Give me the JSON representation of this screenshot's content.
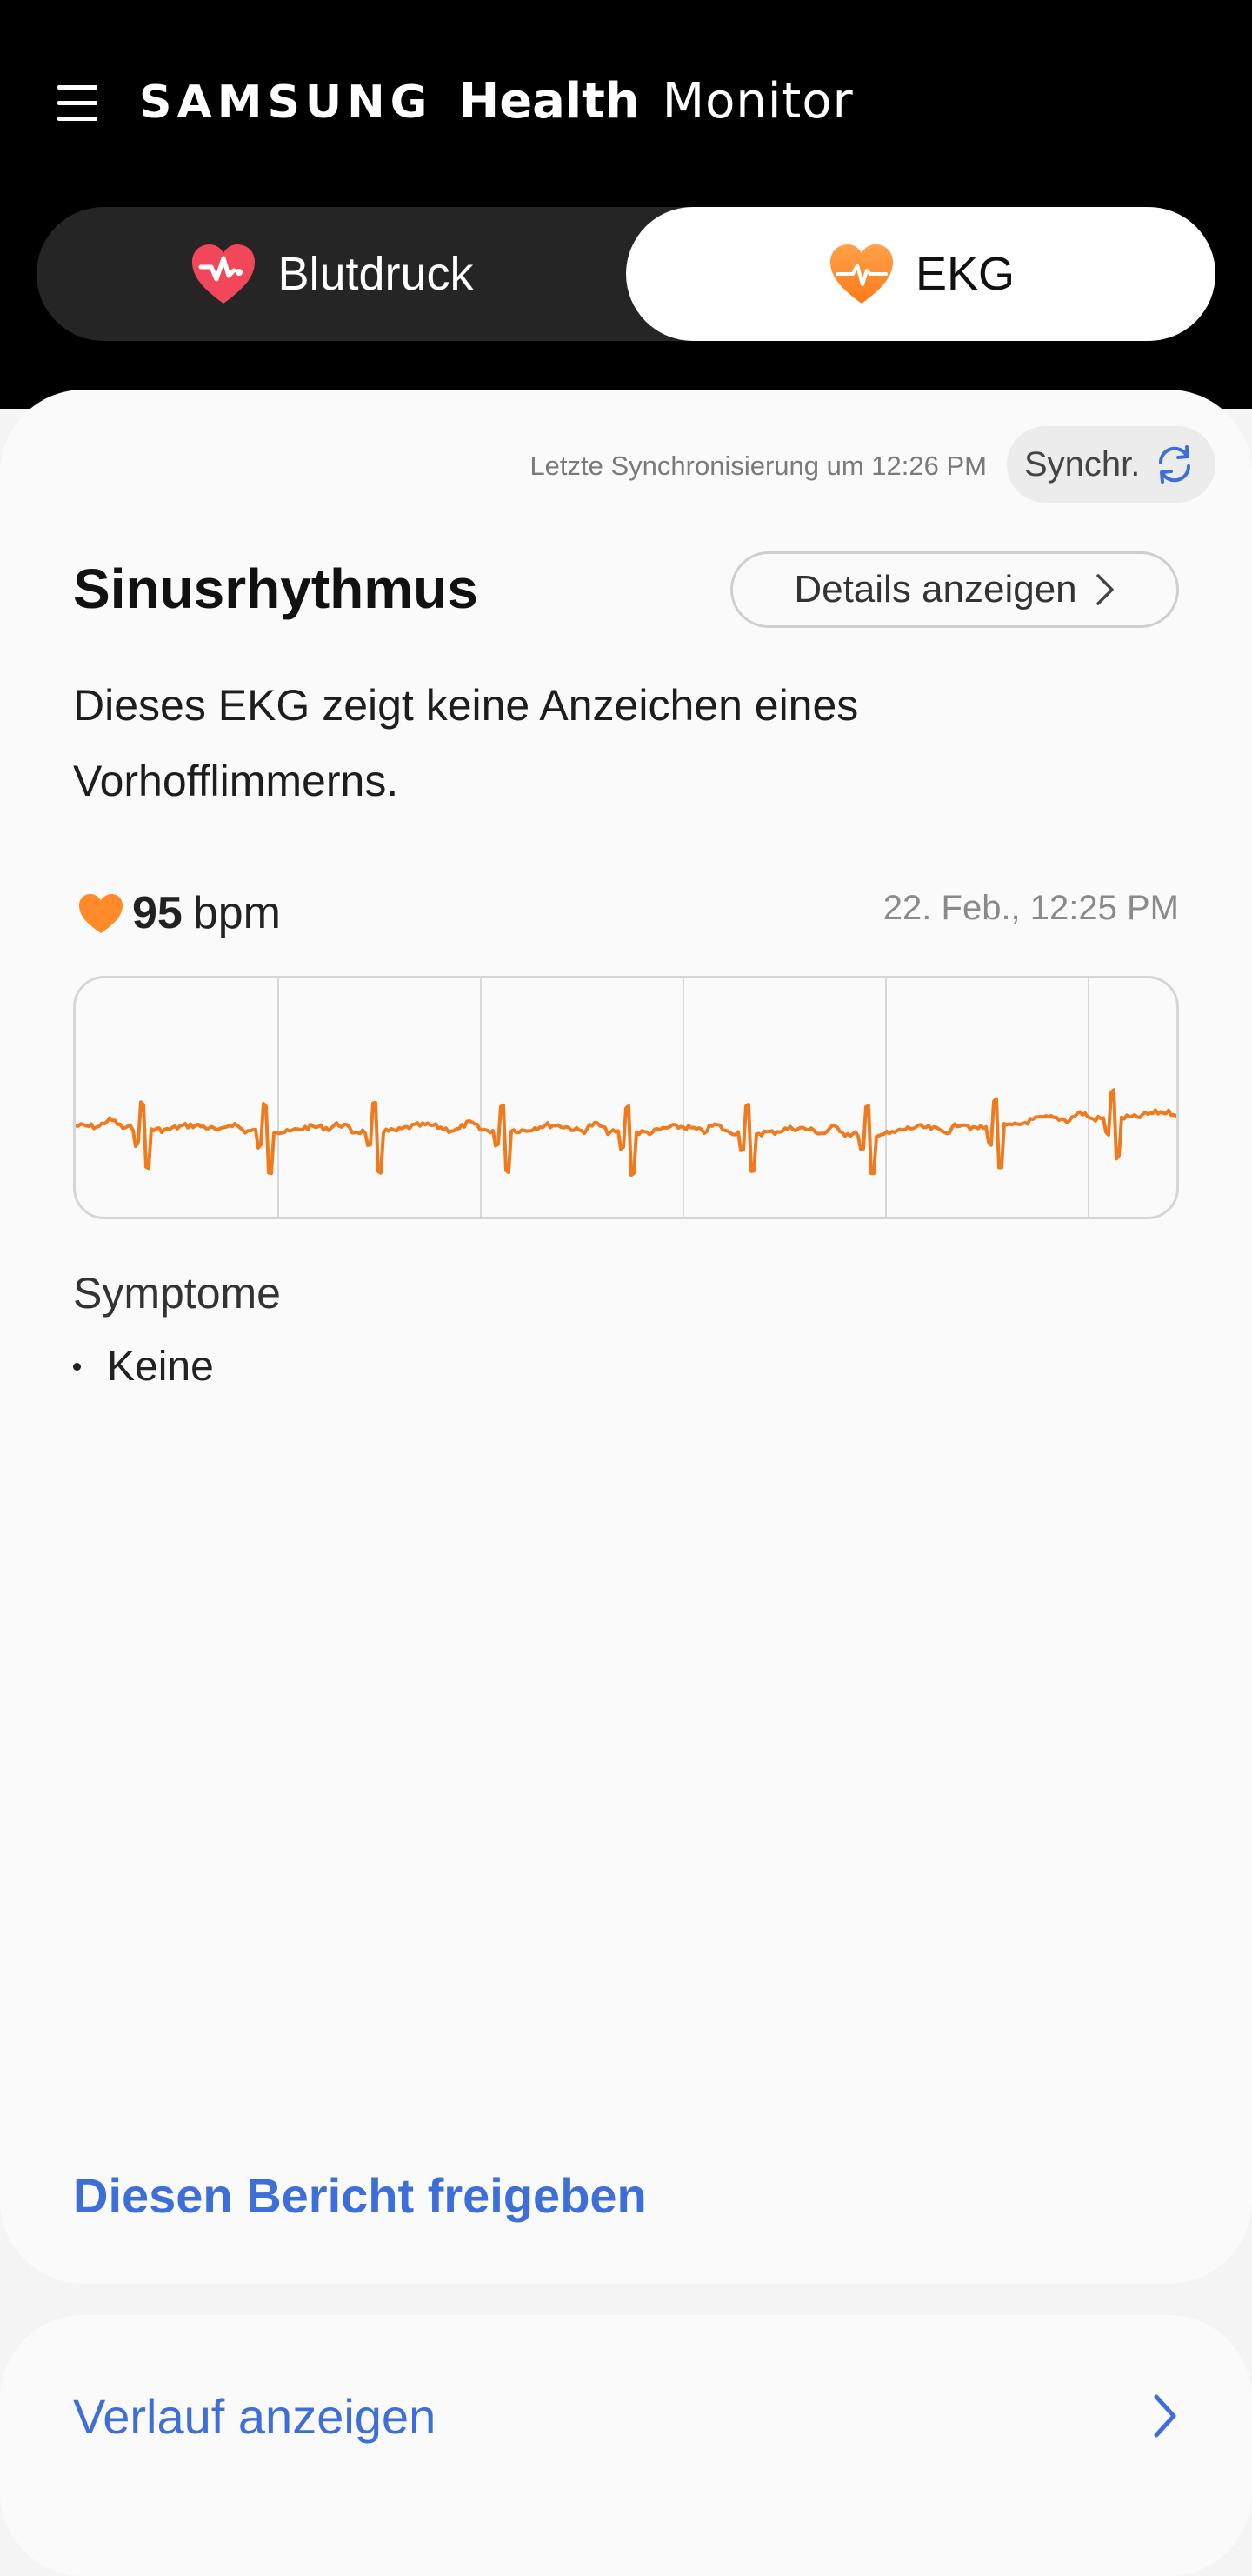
{
  "app": {
    "brand": "SAMSUNG",
    "health": "Health",
    "monitor": "Monitor"
  },
  "tabs": [
    {
      "label": "Blutdruck",
      "icon": "heart-pressure-icon",
      "selected": false
    },
    {
      "label": "EKG",
      "icon": "heart-ekg-icon",
      "selected": true
    }
  ],
  "sync": {
    "last_sync": "Letzte Synchronisierung um 12:26 PM",
    "button_label": "Synchr.",
    "icon": "sync-icon"
  },
  "result": {
    "title": "Sinusrhythmus",
    "details_label": "Details anzeigen",
    "description": "Dieses EKG zeigt keine Anzeichen eines Vorhofflimmerns."
  },
  "measurement": {
    "bpm_value": "95",
    "bpm_unit": "bpm",
    "timestamp": "22. Feb., 12:25 PM"
  },
  "symptoms": {
    "title": "Symptome",
    "items": [
      "Keine"
    ]
  },
  "actions": {
    "share": "Diesen Bericht freigeben",
    "history": "Verlauf anzeigen"
  },
  "colors": {
    "accent": "#3e6fd8",
    "ekg_trace": "#f07a1e",
    "topbar": "#000000",
    "heart_red": "#f2475a",
    "heart_orange": "#ff8a2a"
  }
}
